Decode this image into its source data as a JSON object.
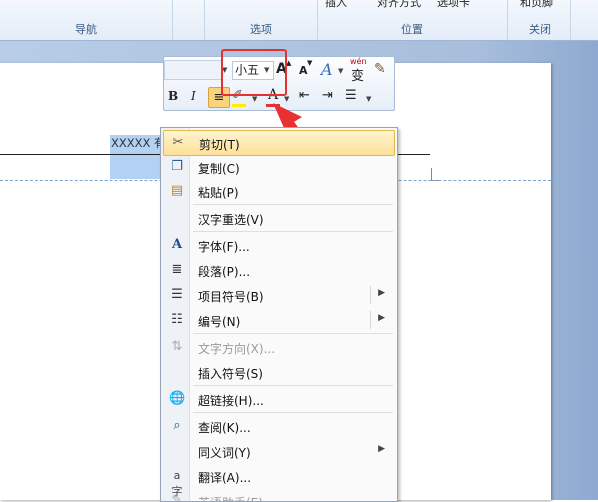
{
  "ribbon": {
    "groups": [
      {
        "label": "导航"
      },
      {
        "label": "选项"
      },
      {
        "label": "位置"
      },
      {
        "label": "关闭"
      }
    ],
    "partial_items": [
      "插入",
      "对齐方式",
      "选项卡",
      "和页脚"
    ]
  },
  "document": {
    "selected_text": "XXXXX 有限公司"
  },
  "mini_toolbar": {
    "font_name": "",
    "font_size": "小五",
    "grow_font": "A",
    "shrink_font": "A",
    "styles": "A",
    "phonetic": "wén",
    "bold": "B",
    "italic": "I",
    "font_color": "A"
  },
  "context_menu": {
    "items": [
      {
        "label": "剪切(T)",
        "icon": "scissors-icon"
      },
      {
        "label": "复制(C)",
        "icon": "copy-icon"
      },
      {
        "label": "粘贴(P)",
        "icon": "paste-icon"
      },
      {
        "label": "汉字重选(V)",
        "icon": ""
      },
      {
        "label": "字体(F)...",
        "icon": "font-icon"
      },
      {
        "label": "段落(P)...",
        "icon": "paragraph-icon"
      },
      {
        "label": "项目符号(B)",
        "icon": "bullets-icon",
        "submenu": true
      },
      {
        "label": "编号(N)",
        "icon": "numbering-icon",
        "submenu": true
      },
      {
        "label": "文字方向(X)...",
        "icon": "text-direction-icon",
        "disabled": true
      },
      {
        "label": "插入符号(S)",
        "icon": ""
      },
      {
        "label": "超链接(H)...",
        "icon": "hyperlink-icon"
      },
      {
        "label": "查阅(K)...",
        "icon": "research-icon"
      },
      {
        "label": "同义词(Y)",
        "icon": "",
        "submenu": true
      },
      {
        "label": "翻译(A)...",
        "icon": "translate-icon"
      },
      {
        "label": "英语助手(E)",
        "icon": "english-assistant-icon",
        "disabled": true
      }
    ]
  },
  "colors": {
    "highlight": "#e53131",
    "menu_hover": "#fde199",
    "selection": "#b3d1f2"
  }
}
